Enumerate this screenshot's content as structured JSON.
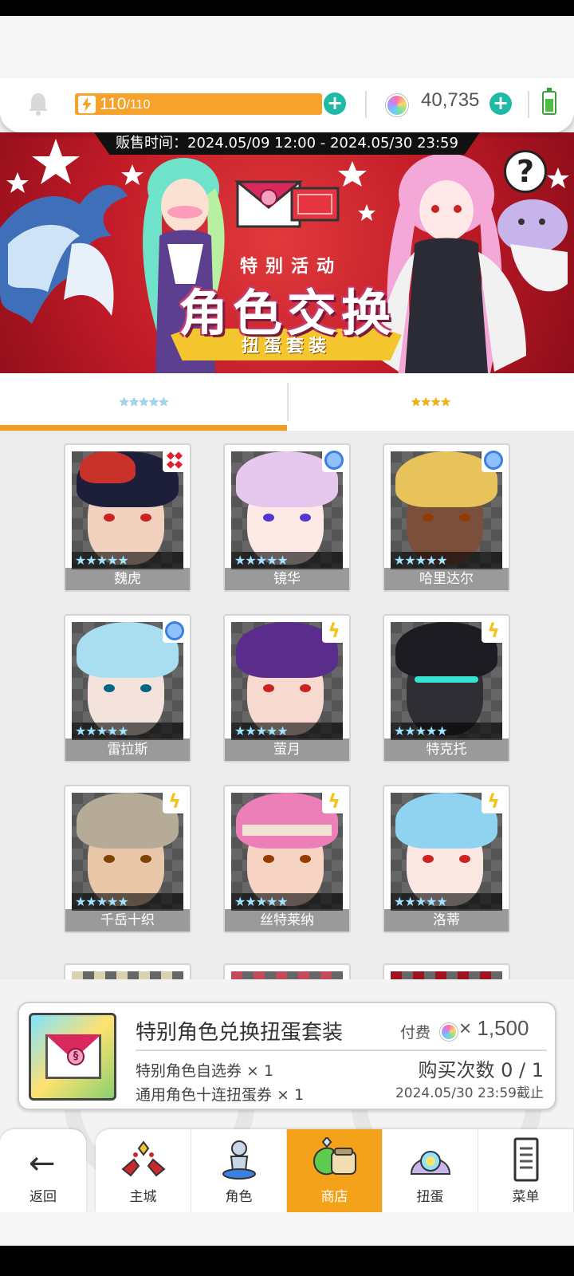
{
  "resources": {
    "energy_current": "110",
    "energy_max": "/110",
    "energy_fraction": 1.0,
    "gems": "40,735",
    "add_symbol": "+"
  },
  "banner": {
    "sale_time": "贩售时间：2024.05/09 12:00 - 2024.05/30 23:59",
    "tag": "特别活动",
    "title": "角色交换",
    "subtitle": "扭蛋套装",
    "help": "?"
  },
  "tabs": [
    {
      "label": "★★★★★",
      "active": true
    },
    {
      "label": "★★★★",
      "active": false
    }
  ],
  "characters": [
    {
      "name": "魏虎",
      "stars": "★★★★★",
      "badge": "diamonds-icon"
    },
    {
      "name": "镜华",
      "stars": "★★★★★",
      "badge": "circle-icon"
    },
    {
      "name": "哈里达尔",
      "stars": "★★★★★",
      "badge": "circle-icon"
    },
    {
      "name": "雷拉斯",
      "stars": "★★★★★",
      "badge": "circle-icon"
    },
    {
      "name": "萤月",
      "stars": "★★★★★",
      "badge": "bolt-icon"
    },
    {
      "name": "特克托",
      "stars": "★★★★★",
      "badge": "bolt-icon"
    },
    {
      "name": "千岳十织",
      "stars": "★★★★★",
      "badge": "bolt-icon"
    },
    {
      "name": "丝特莱纳",
      "stars": "★★★★★",
      "badge": "bolt-icon"
    },
    {
      "name": "洛蒂",
      "stars": "★★★★★",
      "badge": "bolt-icon"
    }
  ],
  "offer": {
    "title": "特别角色兑换扭蛋套装",
    "price_label": "付费",
    "price": "× 1,500",
    "item1": "特别角色自选券 × 1",
    "item2": "通用角色十连扭蛋券 × 1",
    "purchase_count": "购买次数 0 / 1",
    "deadline": "2024.05/30 23:59截止"
  },
  "nav": {
    "back": "返回",
    "items": [
      {
        "label": "主城",
        "icon": "castle-icon"
      },
      {
        "label": "角色",
        "icon": "character-icon"
      },
      {
        "label": "商店",
        "icon": "shop-icon",
        "active": true
      },
      {
        "label": "扭蛋",
        "icon": "gacha-icon"
      },
      {
        "label": "菜单",
        "icon": "menu-icon"
      }
    ]
  },
  "colors": {
    "accent": "#f5a21b",
    "energy": "#f6a22b",
    "plus": "#1fb9a6",
    "banner_red": "#c01a27"
  }
}
